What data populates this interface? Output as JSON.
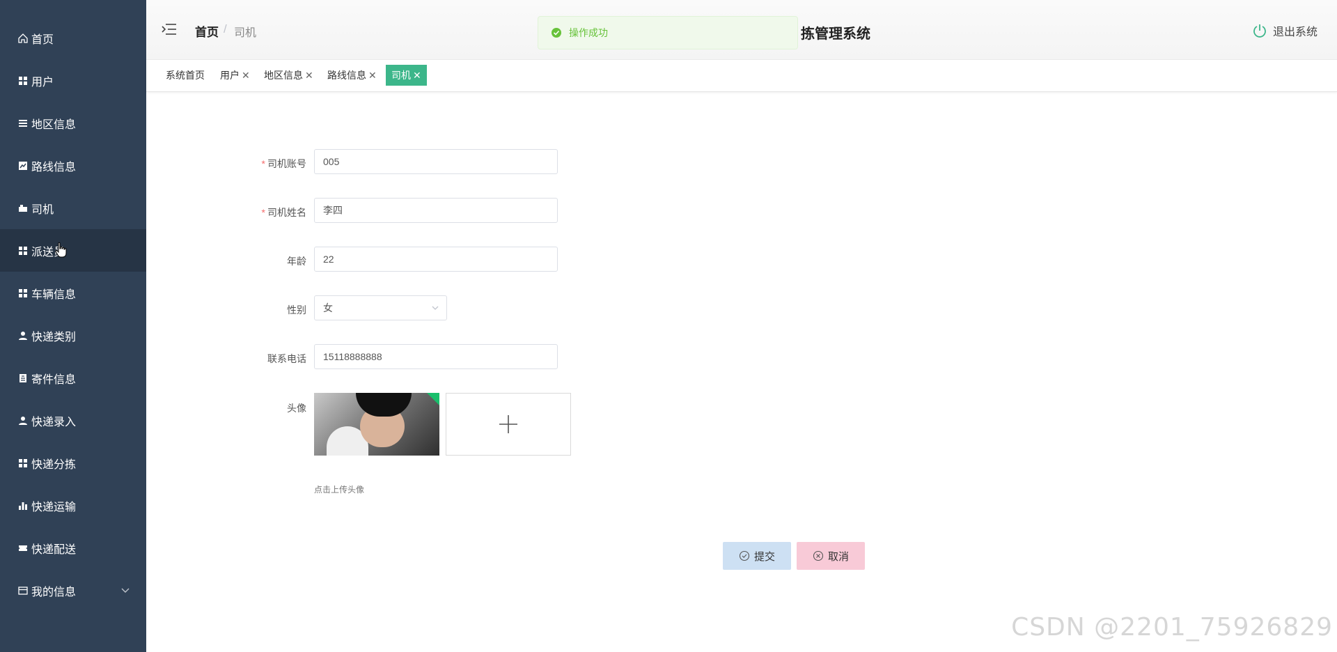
{
  "sidebar": {
    "items": [
      {
        "label": "首页",
        "icon": "home-icon"
      },
      {
        "label": "用户",
        "icon": "grid-icon"
      },
      {
        "label": "地区信息",
        "icon": "list-icon"
      },
      {
        "label": "路线信息",
        "icon": "chart-icon"
      },
      {
        "label": "司机",
        "icon": "truck-icon"
      },
      {
        "label": "派送员",
        "icon": "grid-icon",
        "active": true
      },
      {
        "label": "车辆信息",
        "icon": "grid-icon"
      },
      {
        "label": "快递类别",
        "icon": "user-icon"
      },
      {
        "label": "寄件信息",
        "icon": "clipboard-icon"
      },
      {
        "label": "快递录入",
        "icon": "user-icon"
      },
      {
        "label": "快递分拣",
        "icon": "grid-icon"
      },
      {
        "label": "快递运输",
        "icon": "bar-chart-icon"
      },
      {
        "label": "快递配送",
        "icon": "ticket-icon"
      },
      {
        "label": "我的信息",
        "icon": "card-icon"
      }
    ]
  },
  "header": {
    "breadcrumb_home": "首页",
    "breadcrumb_sep": "/",
    "breadcrumb_current": "司机",
    "title": "拣管理系统",
    "logout": "退出系统"
  },
  "toast": {
    "message": "操作成功",
    "color": "#67c23a"
  },
  "tags": [
    {
      "label": "系统首页",
      "closable": false
    },
    {
      "label": "用户",
      "closable": true
    },
    {
      "label": "地区信息",
      "closable": true
    },
    {
      "label": "路线信息",
      "closable": true
    },
    {
      "label": "司机",
      "closable": true,
      "active": true
    }
  ],
  "form": {
    "account": {
      "label": "司机账号",
      "value": "005"
    },
    "name": {
      "label": "司机姓名",
      "value": "李四"
    },
    "age": {
      "label": "年龄",
      "value": "22"
    },
    "gender": {
      "label": "性别",
      "value": "女"
    },
    "phone": {
      "label": "联系电话",
      "value": "15118888888"
    },
    "avatar": {
      "label": "头像",
      "hint": "点击上传头像"
    },
    "submit": "提交",
    "cancel": "取消"
  },
  "watermark": "CSDN @2201_75926829",
  "colors": {
    "sidebar": "#304156",
    "active_tag": "#3cb68a",
    "submit_bg": "#cde0f3",
    "cancel_bg": "#f8cad7"
  }
}
